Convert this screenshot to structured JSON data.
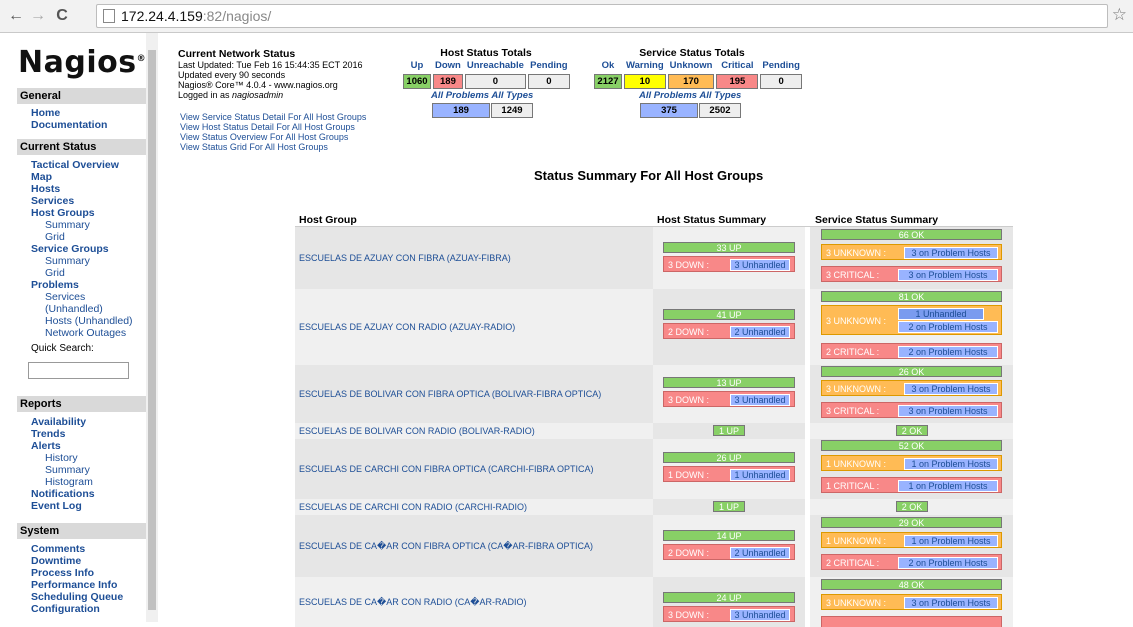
{
  "browser": {
    "url_host": "172.24.4.159",
    "url_path": ":82/nagios/"
  },
  "sidebar": {
    "logo": "Nagios",
    "logo_mark": "®",
    "general": "General",
    "home": "Home",
    "documentation": "Documentation",
    "current_status": "Current Status",
    "tactical_overview": "Tactical Overview",
    "map": "Map",
    "hosts": "Hosts",
    "services": "Services",
    "host_groups": "Host Groups",
    "hg_summary": "Summary",
    "hg_grid": "Grid",
    "service_groups": "Service Groups",
    "sg_summary": "Summary",
    "sg_grid": "Grid",
    "problems": "Problems",
    "p_services": "Services",
    "p_unhandled": "(Unhandled)",
    "p_hosts_unhandled": "Hosts (Unhandled)",
    "p_network_outages": "Network Outages",
    "quick_search": "Quick Search:",
    "reports": "Reports",
    "availability": "Availability",
    "trends": "Trends",
    "alerts": "Alerts",
    "a_history": "History",
    "a_summary": "Summary",
    "a_histogram": "Histogram",
    "notifications": "Notifications",
    "event_log": "Event Log",
    "system": "System",
    "comments": "Comments",
    "downtime": "Downtime",
    "process_info": "Process Info",
    "performance_info": "Performance Info",
    "scheduling_queue": "Scheduling Queue",
    "configuration": "Configuration"
  },
  "status": {
    "title": "Current Network Status",
    "last_updated": "Last Updated: Tue Feb 16 15:44:35 ECT 2016",
    "update_interval": "Updated every 90 seconds",
    "core": "Nagios® Core™ 4.0.4 - www.nagios.org",
    "logged_in_prefix": "Logged in as ",
    "logged_in_user": "nagiosadmin",
    "links": [
      "View Service Status Detail For All Host Groups",
      "View Host Status Detail For All Host Groups",
      "View Status Overview For All Host Groups",
      "View Status Grid For All Host Groups"
    ]
  },
  "host_totals": {
    "title": "Host Status Totals",
    "headers": [
      "Up",
      "Down",
      "Unreachable",
      "Pending"
    ],
    "values": [
      "1060",
      "189",
      "0",
      "0"
    ],
    "all_problems_label": "All Problems",
    "all_types_label": "All Types",
    "all_problems": "189",
    "all_types": "1249"
  },
  "service_totals": {
    "title": "Service Status Totals",
    "headers": [
      "Ok",
      "Warning",
      "Unknown",
      "Critical",
      "Pending"
    ],
    "values": [
      "2127",
      "10",
      "170",
      "195",
      "0"
    ],
    "all_problems_label": "All Problems",
    "all_types_label": "All Types",
    "all_problems": "375",
    "all_types": "2502"
  },
  "summary": {
    "title": "Status Summary For All Host Groups",
    "col_host_group": "Host Group",
    "col_host_status": "Host Status Summary",
    "col_service_status": "Service Status Summary",
    "rows": [
      {
        "name": "ESCUELAS DE AZUAY CON FIBRA (AZUAY-FIBRA)",
        "up": "33 UP",
        "down": "3 DOWN :",
        "down_unh": "3 Unhandled",
        "ok": "66 OK",
        "unknown": "3 UNKNOWN :",
        "unknown_detail": "3 on Problem Hosts",
        "critical": "3 CRITICAL :",
        "critical_detail": "3 on Problem Hosts"
      },
      {
        "name": "ESCUELAS DE AZUAY CON RADIO (AZUAY-RADIO)",
        "up": "41 UP",
        "down": "2 DOWN :",
        "down_unh": "2 Unhandled",
        "ok": "81 OK",
        "unknown": "3 UNKNOWN :",
        "unknown_detail_a": "1 Unhandled",
        "unknown_detail_b": "2 on Problem Hosts",
        "critical": "2 CRITICAL :",
        "critical_detail": "2 on Problem Hosts"
      },
      {
        "name": "ESCUELAS DE BOLIVAR CON FIBRA OPTICA (BOLIVAR-FIBRA OPTICA)",
        "up": "13 UP",
        "down": "3 DOWN :",
        "down_unh": "3 Unhandled",
        "ok": "26 OK",
        "unknown": "3 UNKNOWN :",
        "unknown_detail": "3 on Problem Hosts",
        "critical": "3 CRITICAL :",
        "critical_detail": "3 on Problem Hosts"
      },
      {
        "name": "ESCUELAS DE BOLIVAR CON RADIO (BOLIVAR-RADIO)",
        "up": "1 UP",
        "ok": "2 OK"
      },
      {
        "name": "ESCUELAS DE CARCHI CON FIBRA OPTICA (CARCHI-FIBRA OPTICA)",
        "up": "26 UP",
        "down": "1 DOWN :",
        "down_unh": "1 Unhandled",
        "ok": "52 OK",
        "unknown": "1 UNKNOWN :",
        "unknown_detail": "1 on Problem Hosts",
        "critical": "1 CRITICAL :",
        "critical_detail": "1 on Problem Hosts"
      },
      {
        "name": "ESCUELAS DE CARCHI CON RADIO (CARCHI-RADIO)",
        "up": "1 UP",
        "ok": "2 OK"
      },
      {
        "name": "ESCUELAS DE CA�AR CON FIBRA OPTICA (CA�AR-FIBRA OPTICA)",
        "up": "14 UP",
        "down": "2 DOWN :",
        "down_unh": "2 Unhandled",
        "ok": "29 OK",
        "unknown": "1 UNKNOWN :",
        "unknown_detail": "1 on Problem Hosts",
        "critical": "2 CRITICAL :",
        "critical_detail": "2 on Problem Hosts"
      },
      {
        "name": "ESCUELAS DE CA�AR CON RADIO (CA�AR-RADIO)",
        "up": "24 UP",
        "down": "3 DOWN :",
        "down_unh": "3 Unhandled",
        "ok": "48 OK",
        "unknown": "3 UNKNOWN :",
        "unknown_detail": "3 on Problem Hosts"
      }
    ]
  },
  "colors": {
    "ok_green": "#88d066",
    "down_red": "#f88888",
    "unknown_orange": "#ffbb55",
    "unhandled_blue": "#99b3ff",
    "warning_yellow": "#ffff00",
    "link_blue": "#1d4e96"
  }
}
